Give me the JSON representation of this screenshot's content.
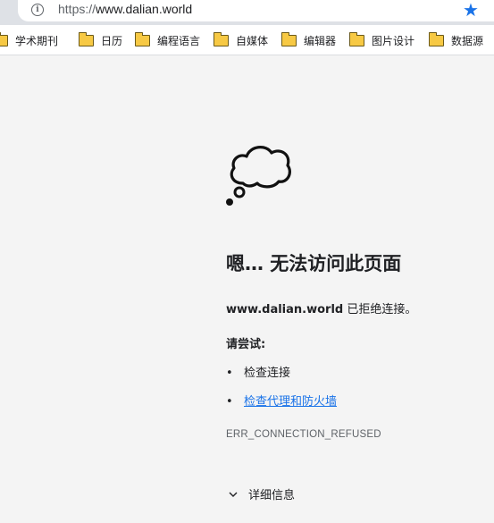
{
  "toolbar": {
    "url_scheme": "https://",
    "url_host": "www.dalian.world",
    "info_icon": "info-icon",
    "bookmark_star": "star-icon",
    "accent_color": "#1a73e8"
  },
  "bookmarks": [
    {
      "label": "学术期刊",
      "icon": "folder-icon"
    },
    {
      "label": "日历",
      "icon": "folder-icon"
    },
    {
      "label": "编程语言",
      "icon": "folder-icon"
    },
    {
      "label": "自媒体",
      "icon": "folder-icon"
    },
    {
      "label": "编辑器",
      "icon": "folder-icon"
    },
    {
      "label": "图片设计",
      "icon": "folder-icon"
    },
    {
      "label": "数据源",
      "icon": "folder-icon"
    }
  ],
  "error": {
    "icon": "thought-cloud-icon",
    "heading": "嗯… 无法访问此页面",
    "host": "www.dalian.world",
    "message_suffix": " 已拒绝连接。",
    "try_label": "请尝试:",
    "suggestions": [
      {
        "text": "检查连接",
        "link": false
      },
      {
        "text": "检查代理和防火墙",
        "link": true
      }
    ],
    "code": "ERR_CONNECTION_REFUSED",
    "details_label": "详细信息"
  }
}
